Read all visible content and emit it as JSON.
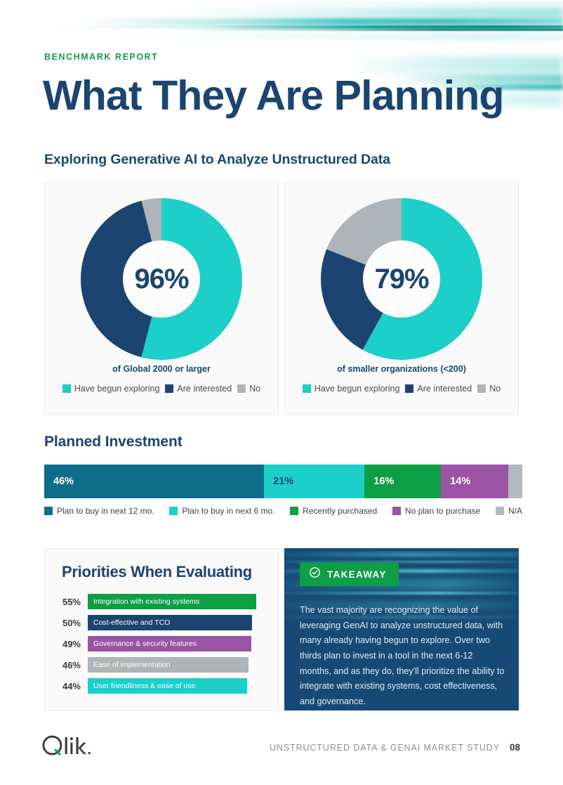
{
  "header": {
    "eyebrow": "BENCHMARK REPORT",
    "title": "What They Are Planning"
  },
  "sections": {
    "generative_ai": "Exploring Generative AI to Analyze Unstructured Data",
    "planned_investment": "Planned Investment"
  },
  "colors": {
    "navy": "#1b4570",
    "teal": "#1ccfc9",
    "gray": "#aeb4b7",
    "green": "#0e9e46",
    "purple": "#9a54a3",
    "deep_teal": "#0e6e89",
    "title_navy": "#1b4570",
    "eyebrow_green": "#139b54"
  },
  "donuts": [
    {
      "center_value": "96%",
      "caption": "of Global 2000 or larger",
      "legend": [
        {
          "label": "Have begun exploring",
          "color": "#1ccfc9"
        },
        {
          "label": "Are interested",
          "color": "#1b4570"
        },
        {
          "label": "No",
          "color": "#aeb4b7"
        }
      ],
      "slices": [
        {
          "name": "Have begun exploring",
          "value": 54,
          "color": "#1ccfc9"
        },
        {
          "name": "Are interested",
          "value": 42,
          "color": "#1b4570"
        },
        {
          "name": "No",
          "value": 4,
          "color": "#aeb4b7"
        }
      ]
    },
    {
      "center_value": "79%",
      "caption": "of smaller organizations (<200)",
      "legend": [
        {
          "label": "Have begun exploring",
          "color": "#1ccfc9"
        },
        {
          "label": "Are interested",
          "color": "#1b4570"
        },
        {
          "label": "No",
          "color": "#aeb4b7"
        }
      ],
      "slices": [
        {
          "name": "Have begun exploring",
          "value": 58,
          "color": "#1ccfc9"
        },
        {
          "name": "Are interested",
          "value": 23,
          "color": "#1b4570"
        },
        {
          "name": "No",
          "value": 19,
          "color": "#aeb4b7"
        }
      ]
    }
  ],
  "investment_bar": {
    "segments": [
      {
        "label": "46%",
        "value": 46,
        "color": "#0e6e89",
        "text_color": "#ffffff"
      },
      {
        "label": "21%",
        "value": 21,
        "color": "#1ccfc9",
        "text_color": "#1b4570"
      },
      {
        "label": "16%",
        "value": 16,
        "color": "#0e9e46",
        "text_color": "#ffffff"
      },
      {
        "label": "14%",
        "value": 14,
        "color": "#9a54a3",
        "text_color": "#ffffff"
      },
      {
        "label": "",
        "value": 3,
        "color": "#b3b9bc",
        "text_color": "#ffffff"
      }
    ],
    "legend": [
      {
        "label": "Plan to buy in next 12 mo.",
        "color": "#0e6e89"
      },
      {
        "label": "Plan to buy in next 6 mo.",
        "color": "#1ccfc9"
      },
      {
        "label": "Recently purchased",
        "color": "#0e9e46"
      },
      {
        "label": "No plan to purchase",
        "color": "#9a54a3"
      },
      {
        "label": "N/A",
        "color": "#b3b9bc"
      }
    ]
  },
  "priorities": {
    "title": "Priorities When Evaluating",
    "items": [
      {
        "pct": "55%",
        "value": 55,
        "label": "Integration with existing systems",
        "color": "#0e9e46"
      },
      {
        "pct": "50%",
        "value": 50,
        "label": "Cost-effective and TCO",
        "color": "#1b4570"
      },
      {
        "pct": "49%",
        "value": 49,
        "label": "Governance & security features",
        "color": "#9a54a3"
      },
      {
        "pct": "46%",
        "value": 46,
        "label": "Ease of implementation",
        "color": "#aeb4b7"
      },
      {
        "pct": "44%",
        "value": 44,
        "label": "User friendliness & ease of use",
        "color": "#1ccfc9"
      }
    ]
  },
  "takeaway": {
    "badge_label": "TAKEAWAY",
    "body": "The vast majority are recognizing the value of leveraging GenAI to analyze unstructured data, with many already having begun to explore. Over two thirds plan to invest in a tool in the next 6-12 months, and as they do, they'll prioritize the ability to integrate with existing systems, cost effectiveness, and governance."
  },
  "footer": {
    "logo_text": "Qlik.",
    "study_name": "UNSTRUCTURED DATA & GENAI MARKET STUDY",
    "page_number": "08"
  },
  "chart_data": [
    {
      "type": "pie",
      "title": "of Global 2000 or larger",
      "center_label": "96%",
      "labels": [
        "Have begun exploring",
        "Are interested",
        "No"
      ],
      "values": [
        54,
        42,
        4
      ],
      "colors": [
        "#1ccfc9",
        "#1b4570",
        "#aeb4b7"
      ],
      "legend_position": "bottom",
      "donut": true
    },
    {
      "type": "pie",
      "title": "of smaller organizations (<200)",
      "center_label": "79%",
      "labels": [
        "Have begun exploring",
        "Are interested",
        "No"
      ],
      "values": [
        58,
        23,
        19
      ],
      "colors": [
        "#1ccfc9",
        "#1b4570",
        "#aeb4b7"
      ],
      "legend_position": "bottom",
      "donut": true
    },
    {
      "type": "bar",
      "title": "Planned Investment",
      "orientation": "stacked-horizontal",
      "categories": [
        "Plan to buy in next 12 mo.",
        "Plan to buy in next 6 mo.",
        "Recently purchased",
        "No plan to purchase",
        "N/A"
      ],
      "values": [
        46,
        21,
        16,
        14,
        3
      ],
      "data_labels": [
        "46%",
        "21%",
        "16%",
        "14%",
        ""
      ],
      "colors": [
        "#0e6e89",
        "#1ccfc9",
        "#0e9e46",
        "#9a54a3",
        "#b3b9bc"
      ],
      "xlabel": "",
      "ylabel": "",
      "xlim": [
        0,
        100
      ],
      "legend_position": "bottom",
      "grid": false
    },
    {
      "type": "bar",
      "title": "Priorities When Evaluating",
      "orientation": "horizontal",
      "categories": [
        "Integration with existing systems",
        "Cost-effective and TCO",
        "Governance & security features",
        "Ease of implementation",
        "User friendliness & ease of use"
      ],
      "values": [
        55,
        50,
        49,
        46,
        44
      ],
      "data_labels": [
        "55%",
        "50%",
        "49%",
        "46%",
        "44%"
      ],
      "colors": [
        "#0e9e46",
        "#1b4570",
        "#9a54a3",
        "#aeb4b7",
        "#1ccfc9"
      ],
      "xlabel": "",
      "ylabel": "",
      "xlim": [
        0,
        55
      ],
      "legend_position": "none",
      "grid": false
    }
  ]
}
